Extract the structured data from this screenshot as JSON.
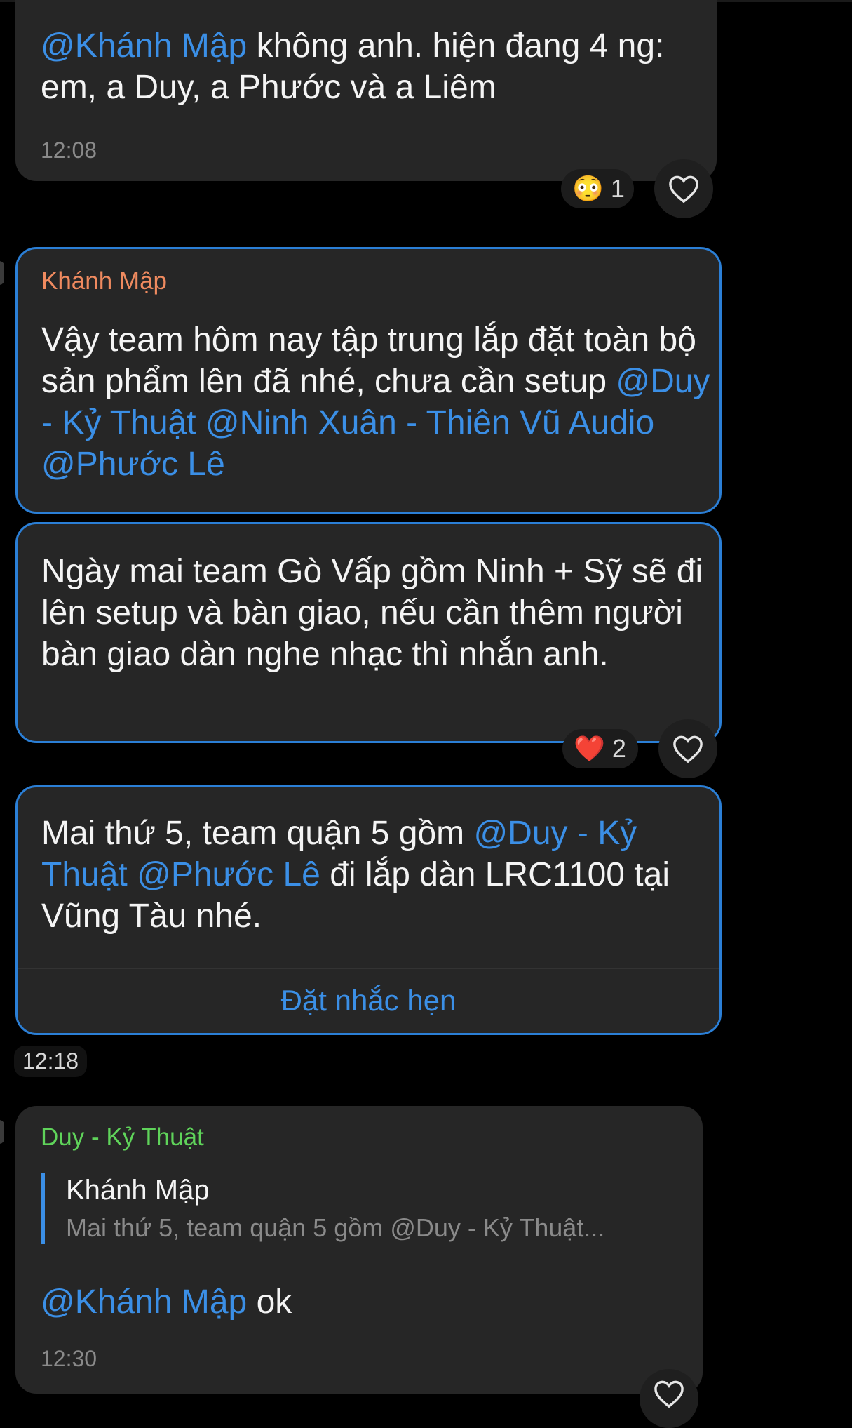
{
  "messages": [
    {
      "segments": [
        {
          "text": "@Khánh Mập",
          "mention": true
        },
        {
          "text": " không anh. hiện đang 4 ng: em, a Duy, a Phước và a Liêm",
          "mention": false
        }
      ],
      "time": "12:08",
      "reaction": {
        "emoji": "😳",
        "count": "1"
      }
    },
    {
      "sender": "Khánh Mập",
      "sender_color": "#ef8a5f",
      "segments": [
        {
          "text": "Vậy team hôm nay tập trung lắp đặt toàn bộ sản phẩm lên đã nhé, chưa cần setup ",
          "mention": false
        },
        {
          "text": "@Duy - Kỷ Thuật",
          "mention": true
        },
        {
          "text": " ",
          "mention": false
        },
        {
          "text": "@Ninh Xuân - Thiên Vũ Audio",
          "mention": true
        },
        {
          "text": " ",
          "mention": false
        },
        {
          "text": "@Phước Lê",
          "mention": true
        }
      ]
    },
    {
      "segments": [
        {
          "text": "Ngày mai team Gò Vấp gồm Ninh + Sỹ sẽ đi lên setup và bàn giao, nếu cần thêm người bàn giao dàn nghe nhạc thì nhắn anh.",
          "mention": false
        }
      ],
      "reaction": {
        "emoji": "❤️",
        "count": "2"
      }
    },
    {
      "segments": [
        {
          "text": "Mai thứ 5, team quận 5 gồm ",
          "mention": false
        },
        {
          "text": "@Duy - Kỷ Thuật",
          "mention": true
        },
        {
          "text": " ",
          "mention": false
        },
        {
          "text": "@Phước Lê",
          "mention": true
        },
        {
          "text": " đi lắp dàn LRC1100 tại Vũng Tàu nhé.",
          "mention": false
        }
      ],
      "action_label": "Đặt nhắc hẹn"
    },
    {
      "sender": "Duy - Kỷ Thuật",
      "sender_color": "#5fd35a",
      "reply": {
        "name": "Khánh Mập",
        "text": "Mai thứ 5, team quận 5 gồm @Duy - Kỷ Thuật..."
      },
      "segments": [
        {
          "text": "@Khánh Mập",
          "mention": true
        },
        {
          "text": " ok",
          "mention": false
        }
      ],
      "time": "12:30"
    }
  ],
  "group_time": "12:18",
  "icons": {
    "heart": "heart-outline-icon",
    "mention_color": "#3b8fe6",
    "selected_border": "#2b7fd6"
  }
}
